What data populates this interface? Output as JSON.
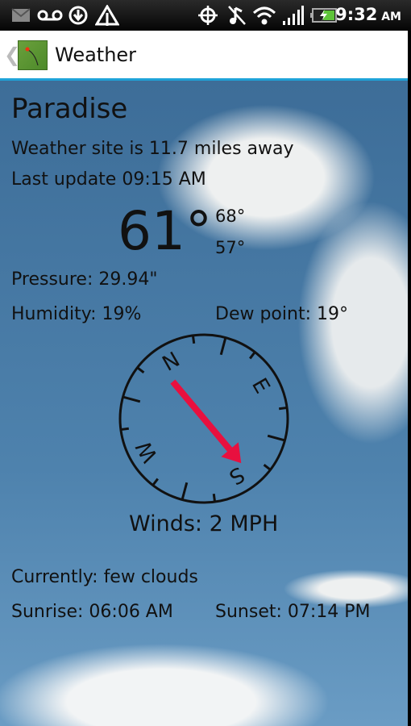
{
  "status_bar": {
    "time": "9:32",
    "ampm": "AM",
    "icons": [
      "gmail-icon",
      "voicemail-icon",
      "download-icon",
      "alert-triangle-icon",
      "gps-icon",
      "music-muted-icon",
      "wifi-icon",
      "signal-icon",
      "battery-charging-icon"
    ]
  },
  "action_bar": {
    "title": "Weather",
    "back_glyph": "❮"
  },
  "weather": {
    "city": "Paradise",
    "distance": "Weather site is 11.7 miles away",
    "last_update": "Last update 09:15 AM",
    "temperature": "61°",
    "high": "68°",
    "low": "57°",
    "pressure": "Pressure: 29.94\"",
    "humidity": "Humidity: 19%",
    "dew_point": "Dew point: 19°",
    "compass": {
      "labels": [
        "N",
        "E",
        "S",
        "W"
      ],
      "wind_direction_deg": 140,
      "arrow_color": "#e8103f"
    },
    "winds": "Winds: 2 MPH",
    "currently": "Currently: few clouds",
    "sunrise": "Sunrise: 06:06 AM",
    "sunset": "Sunset: 07:14 PM"
  }
}
